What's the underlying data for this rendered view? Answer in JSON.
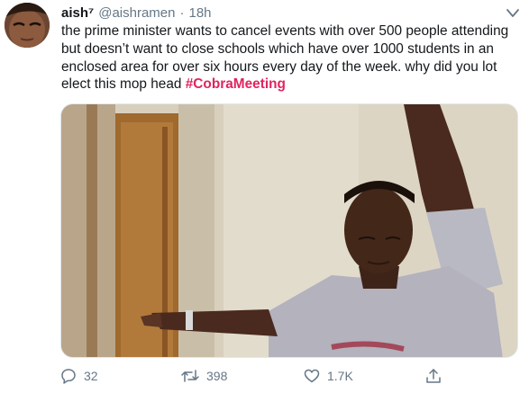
{
  "tweet": {
    "author": {
      "display_name": "aish⁷",
      "handle": "@aishramen",
      "avatar_icon": "avatar-photo"
    },
    "separator": "·",
    "time": "18h",
    "text": "the prime minister wants to cancel events with over 500 people attending but doesn’t want to close schools which have over 1000 students in an enclosed area for over six hours every day of the week. why did you lot elect this mop head ",
    "hashtag": "#CobraMeeting",
    "media": {
      "icon": "meme-photo"
    },
    "actions": {
      "reply": {
        "icon": "reply-icon",
        "count": "32"
      },
      "retweet": {
        "icon": "retweet-icon",
        "count": "398"
      },
      "like": {
        "icon": "heart-icon",
        "count": "1.7K"
      },
      "share": {
        "icon": "share-icon"
      }
    },
    "menu_icon": "chevron-down-icon",
    "colors": {
      "text": "#14171a",
      "secondary": "#657786",
      "hashtag": "#e0245e"
    }
  }
}
